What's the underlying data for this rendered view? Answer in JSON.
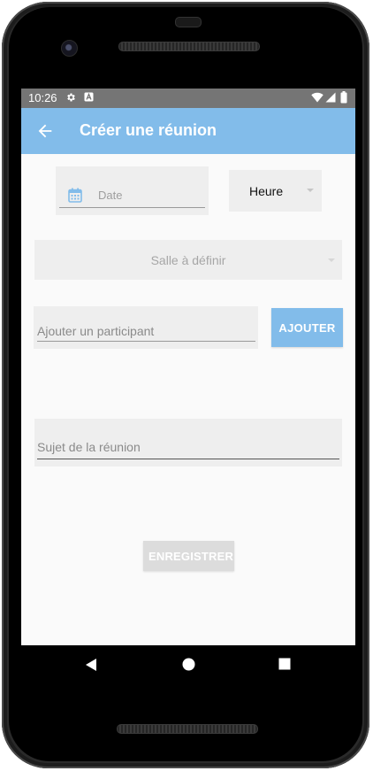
{
  "status_bar": {
    "time": "10:26",
    "icons": [
      "settings-gear",
      "a-notification",
      "wifi",
      "signal",
      "battery"
    ]
  },
  "app_bar": {
    "title": "Créer une réunion",
    "back_icon": "arrow-left",
    "color": "#82bcea"
  },
  "form": {
    "date": {
      "placeholder": "Date",
      "icon": "calendar"
    },
    "heure": {
      "label": "Heure"
    },
    "salle": {
      "label": "Salle à définir"
    },
    "participant": {
      "placeholder": "Ajouter un participant",
      "button_label": "AJOUTER"
    },
    "sujet": {
      "placeholder": "Sujet de la réunion"
    },
    "save_button_label": "ENREGISTRER"
  },
  "nav_bar": {
    "icons": [
      "back-triangle",
      "home-circle",
      "recents-square"
    ]
  }
}
